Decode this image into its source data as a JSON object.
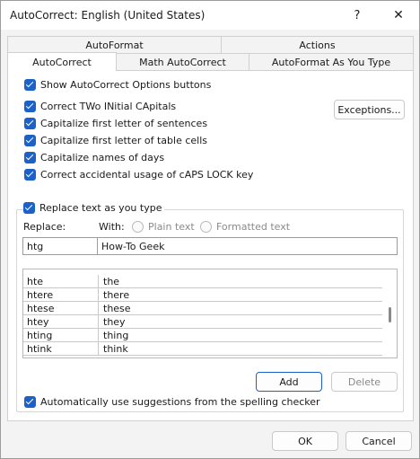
{
  "window": {
    "title": "AutoCorrect: English (United States)",
    "help_glyph": "?",
    "close_glyph": "✕"
  },
  "tabs_back": [
    "AutoFormat",
    "Actions"
  ],
  "tabs_front": [
    "AutoCorrect",
    "Math AutoCorrect",
    "AutoFormat As You Type"
  ],
  "active_tab": "AutoCorrect",
  "options": {
    "show_buttons": "Show AutoCorrect Options buttons",
    "two_initial": "Correct TWo INitial CApitals",
    "first_sentence": "Capitalize first letter of sentences",
    "first_table": "Capitalize first letter of table cells",
    "names_days": "Capitalize names of days",
    "caps_lock": "Correct accidental usage of cAPS LOCK key",
    "exceptions_button": "Exceptions...",
    "replace_as_type": "Replace text as you type",
    "spelling_suggestions": "Automatically use suggestions from the spelling checker"
  },
  "replace": {
    "replace_label": "Replace:",
    "with_label": "With:",
    "plain_text": "Plain text",
    "formatted_text": "Formatted text",
    "replace_value": "htg",
    "with_value": "How-To Geek"
  },
  "list": {
    "rows": [
      {
        "from": "hte",
        "to": "the"
      },
      {
        "from": "htere",
        "to": "there"
      },
      {
        "from": "htese",
        "to": "these"
      },
      {
        "from": "htey",
        "to": "they"
      },
      {
        "from": "hting",
        "to": "thing"
      },
      {
        "from": "htink",
        "to": "think"
      }
    ]
  },
  "buttons": {
    "add": "Add",
    "delete": "Delete",
    "ok": "OK",
    "cancel": "Cancel"
  },
  "colors": {
    "accent": "#1b61c8"
  }
}
